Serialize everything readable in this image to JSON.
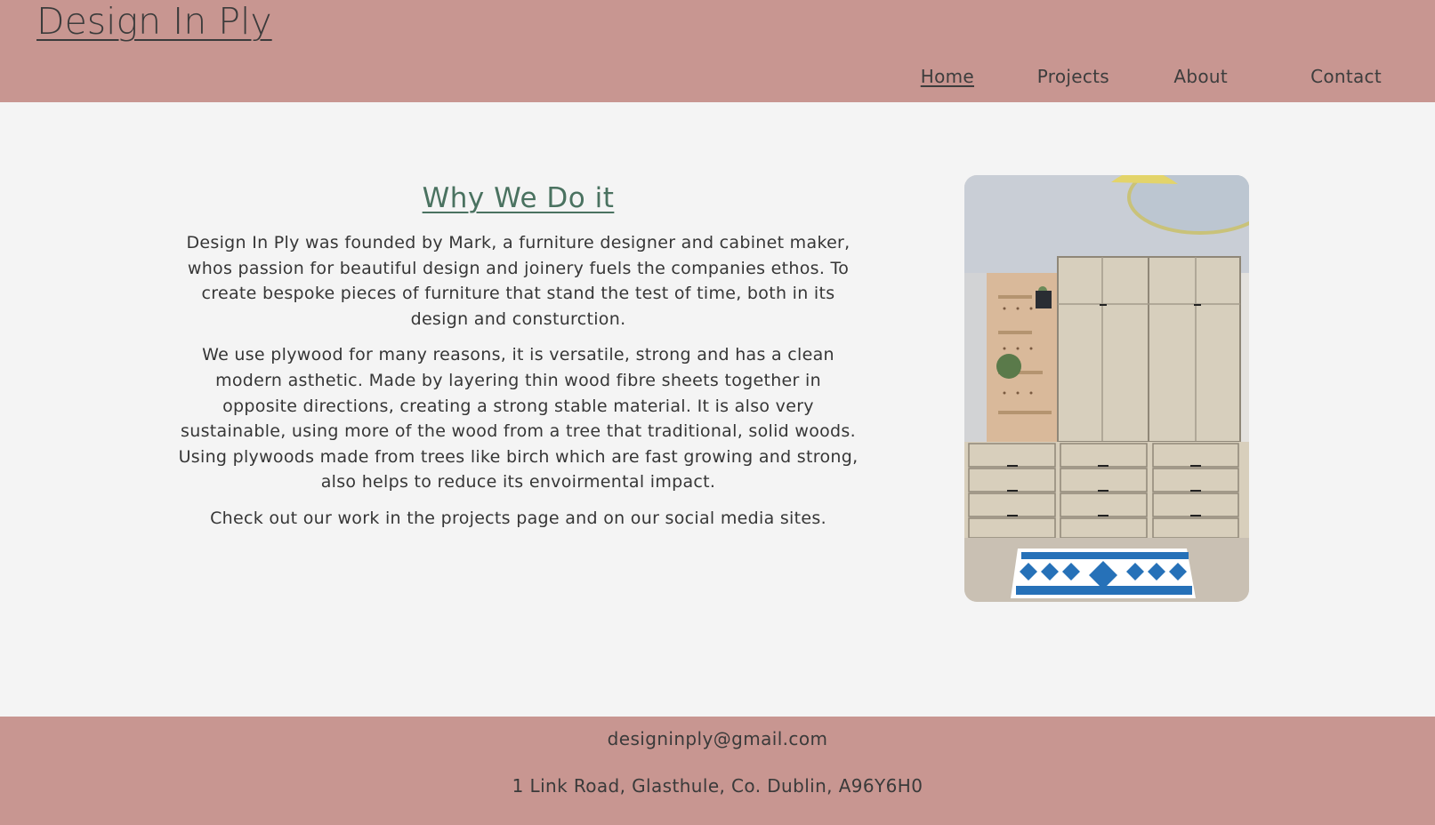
{
  "header": {
    "logo": "Design In Ply",
    "nav": [
      {
        "label": "Home",
        "active": true
      },
      {
        "label": "Projects",
        "active": false
      },
      {
        "label": "About",
        "active": false
      },
      {
        "label": "Contact",
        "active": false
      }
    ]
  },
  "main": {
    "title": "Why We Do it",
    "paragraphs": [
      "Design In Ply was founded by Mark, a furniture designer and cabinet maker, whos passion for beautiful design and joinery fuels the companies ethos. To create bespoke pieces of furniture that stand the test of time, both in its design and consturction.",
      "We use plywood for many reasons, it is versatile, strong and has a clean modern asthetic. Made by layering thin wood fibre sheets together in opposite directions, creating a strong stable material. It is also very sustainable, using more of the wood from a tree that traditional, solid woods. Using plywoods made from trees like birch which are fast growing and strong, also helps to reduce its envoirmental impact.",
      "Check out our work in the projects page and on our social media sites."
    ]
  },
  "footer": {
    "email": "designinply@gmail.com",
    "address": "1 Link Road, Glasthule, Co. Dublin, A96Y6H0"
  },
  "colors": {
    "header_bg": "#c89691",
    "page_bg": "#f4f4f4",
    "title_green": "#4a7260"
  }
}
